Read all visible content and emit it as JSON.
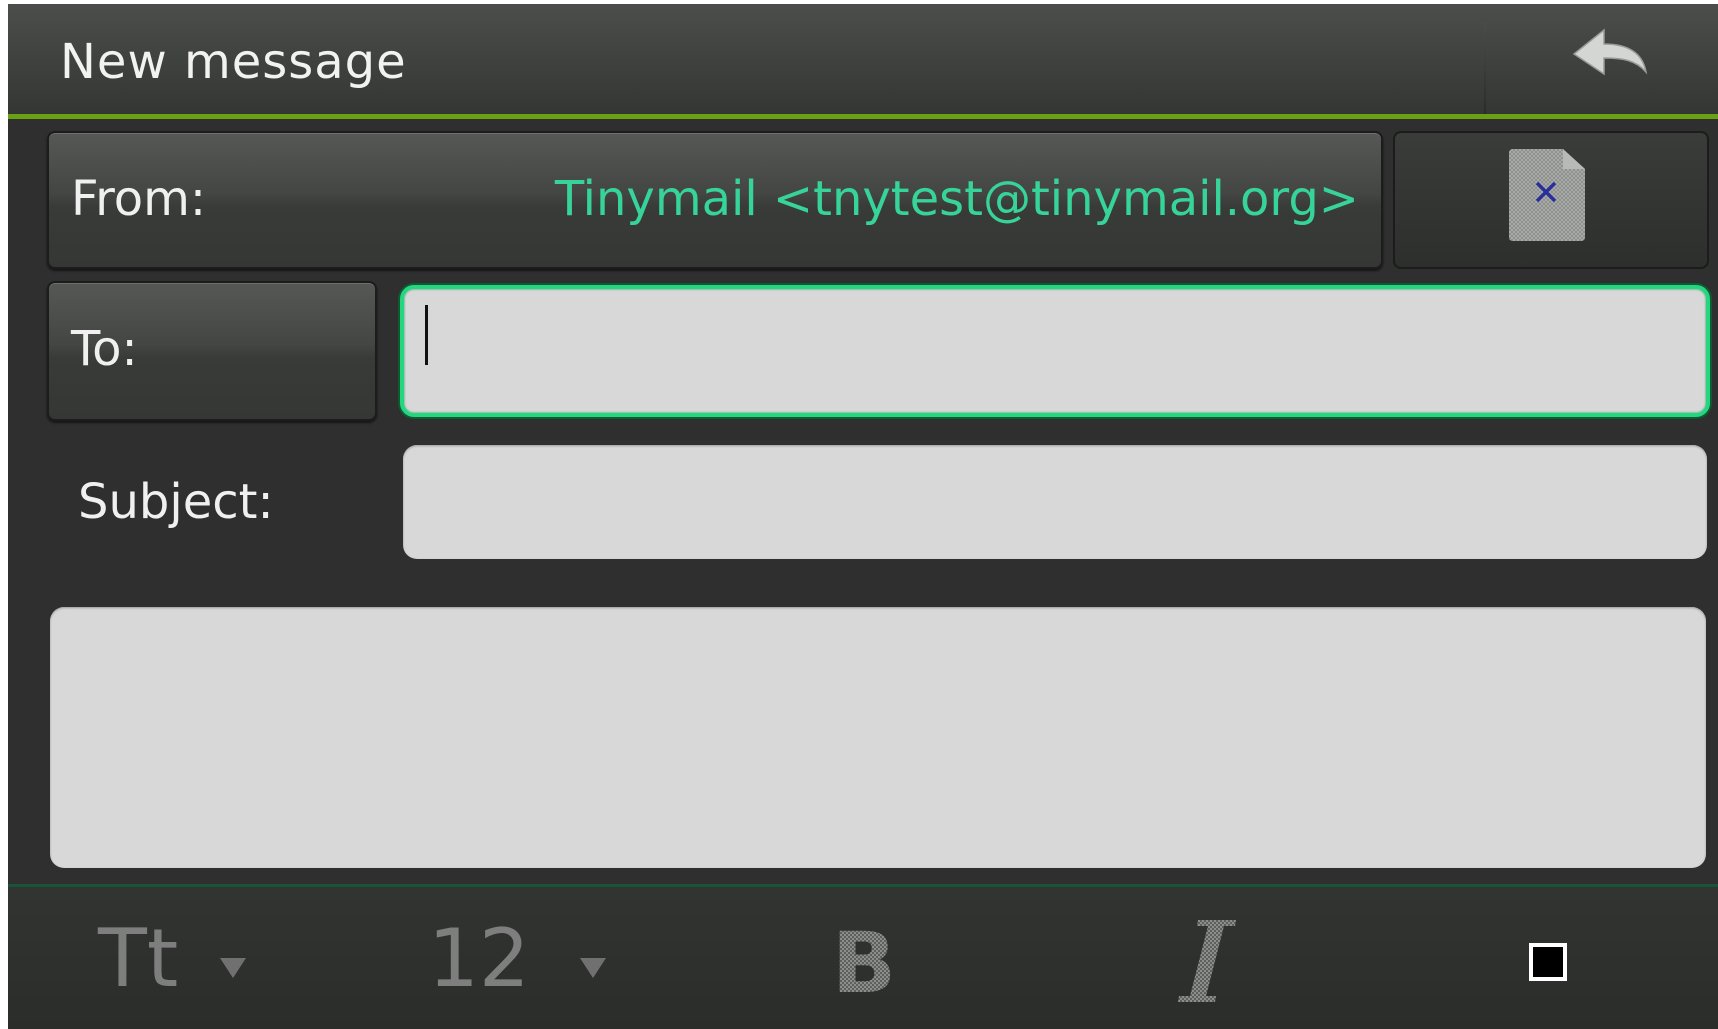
{
  "window": {
    "title": "New message"
  },
  "titlebar": {
    "back_icon": "back-arrow-icon"
  },
  "header": {
    "from_label": "From:",
    "from_value": "Tinymail <tnytest@tinymail.org>",
    "attach_icon": "attachment-file-icon",
    "to_label": "To:",
    "to_value": "",
    "subject_label": "Subject:",
    "subject_value": ""
  },
  "body": {
    "text": ""
  },
  "toolbar": {
    "font_face_label": "Tt",
    "font_size_label": "12",
    "bold_icon": "bold-icon",
    "italic_icon": "italic-icon",
    "bullet_icon": "checkbox-bullet-icon"
  },
  "colors": {
    "accent_green": "#37d49a",
    "focus_border": "#25d67f",
    "title_underline": "#6aa013"
  }
}
